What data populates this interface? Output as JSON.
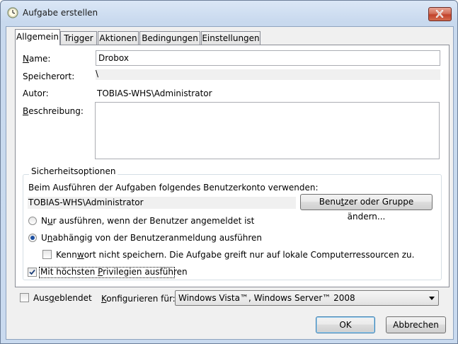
{
  "window": {
    "title": "Aufgabe erstellen",
    "icon": "task-clock-icon"
  },
  "tabs": [
    {
      "label": "Allgemein",
      "active": true
    },
    {
      "label": "Trigger",
      "active": false
    },
    {
      "label": "Aktionen",
      "active": false
    },
    {
      "label": "Bedingungen",
      "active": false
    },
    {
      "label": "Einstellungen",
      "active": false
    }
  ],
  "general": {
    "name_label": "Name:",
    "name_value": "Drobox",
    "location_label": "Speicherort:",
    "location_value": "\\",
    "author_label": "Autor:",
    "author_value": "TOBIAS-WHS\\Administrator",
    "description_label": "Beschreibung:",
    "description_value": ""
  },
  "security": {
    "group_title": "Sicherheitsoptionen",
    "account_prompt": "Beim Ausführen der Aufgaben folgendes Benutzerkonto verwenden:",
    "account_value": "TOBIAS-WHS\\Administrator",
    "change_button": "Benutzer oder Gruppe ändern...",
    "radio_logged_on": "Nur ausführen, wenn der Benutzer angemeldet ist",
    "radio_logged_on_checked": false,
    "radio_independent": "Unabhängig von der Benutzeranmeldung ausführen",
    "radio_independent_checked": true,
    "no_password": "Kennwort nicht speichern. Die Aufgabe greift nur auf lokale Computerressourcen zu.",
    "no_password_checked": false,
    "highest_privileges": "Mit höchsten Privilegien ausführen",
    "highest_privileges_checked": true
  },
  "bottom": {
    "hidden_label": "Ausgeblendet",
    "hidden_checked": false,
    "configure_label": "Konfigurieren für:",
    "configure_value": "Windows Vista™, Windows Server™ 2008"
  },
  "buttons": {
    "ok": "OK",
    "cancel": "Abbrechen"
  }
}
